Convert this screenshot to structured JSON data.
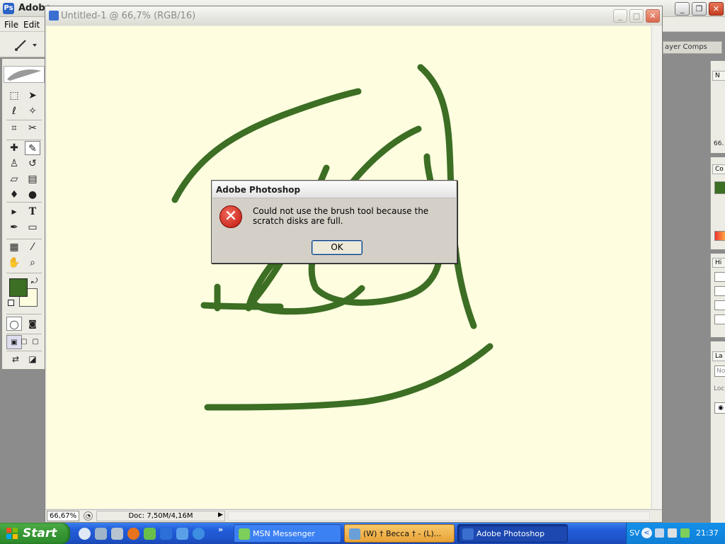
{
  "app": {
    "title": "Adobe",
    "logo": "Ps",
    "menu": [
      "File",
      "Edit"
    ],
    "colors": {
      "foreground": "#3c6e24",
      "background": "#fefddf"
    }
  },
  "palettes": {
    "layer_comps_tab": "ayer Comps",
    "navigator_tab": "N",
    "navigator_zoom": "66.",
    "color_tab": "Co",
    "history_tab": "Hi",
    "layers_tab": "La",
    "layers_mode": "Nor",
    "layers_lock": "Loc"
  },
  "toolbox": {
    "tools": [
      "rect-marquee-icon",
      "move-icon",
      "lasso-icon",
      "magic-wand-icon",
      "crop-icon",
      "slice-icon",
      "healing-brush-icon",
      "brush-icon",
      "clone-stamp-icon",
      "history-brush-icon",
      "eraser-icon",
      "gradient-icon",
      "blur-icon",
      "dodge-icon",
      "path-select-icon",
      "type-icon",
      "pen-icon",
      "shape-icon",
      "notes-icon",
      "eyedropper-icon",
      "hand-icon",
      "zoom-icon"
    ],
    "active_tool": "brush-icon",
    "type_glyph": "T"
  },
  "document": {
    "title": "Untitled-1 @ 66,7% (RGB/16)",
    "zoom": "66,67%",
    "doc_info": "Doc: 7,50M/4,16M"
  },
  "dialog": {
    "title": "Adobe Photoshop",
    "message": "Could not use the brush tool because the scratch disks are full.",
    "ok_label": "OK",
    "icon": "error-icon"
  },
  "taskbar": {
    "start_label": "Start",
    "more_glyph": "»",
    "tasks": [
      {
        "label": "MSN Messenger"
      },
      {
        "label": "(W)   † Becca † - (L)..."
      },
      {
        "label": "Adobe Photoshop"
      }
    ],
    "tray": {
      "language": "SV",
      "back_glyph": "<",
      "clock": "21:37"
    }
  }
}
